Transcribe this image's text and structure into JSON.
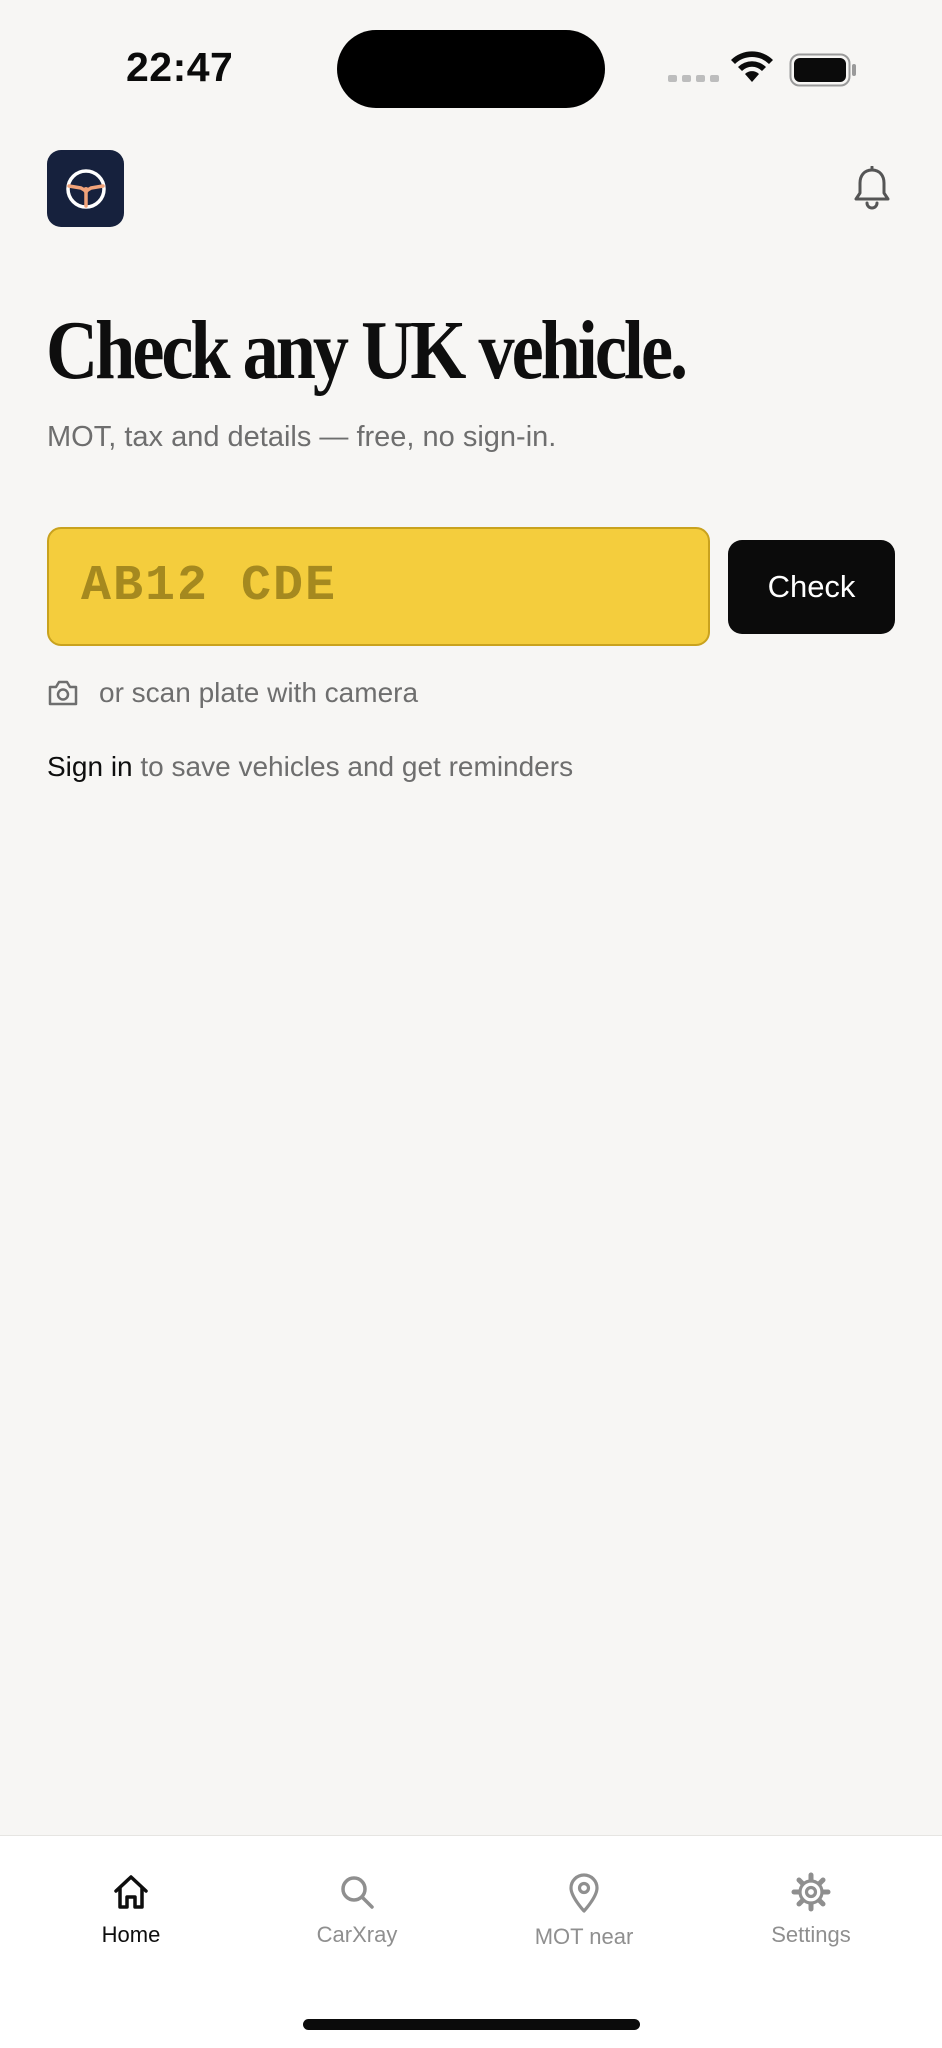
{
  "status": {
    "time": "22:47"
  },
  "header": {
    "logo_icon": "steering-wheel-icon",
    "notification_icon": "bell-icon"
  },
  "hero": {
    "title": "Check any UK vehicle.",
    "subtitle": "MOT, tax and details — free, no sign-in."
  },
  "plate": {
    "value": "",
    "placeholder": "AB12 CDE",
    "check_label": "Check"
  },
  "scan": {
    "label": "or scan plate with camera"
  },
  "signin": {
    "link": "Sign in",
    "text": " to save vehicles and get reminders"
  },
  "tabs": [
    {
      "label": "Home",
      "icon": "home-icon",
      "active": true
    },
    {
      "label": "CarXray",
      "icon": "search-icon",
      "active": false
    },
    {
      "label": "MOT near",
      "icon": "location-pin-icon",
      "active": false
    },
    {
      "label": "Settings",
      "icon": "gear-icon",
      "active": false
    }
  ],
  "colors": {
    "background": "#f7f6f4",
    "plate_yellow": "#f4cd3d",
    "logo_navy": "#16213d",
    "logo_accent": "#f1a37a",
    "button_black": "#0b0b0b",
    "muted_text": "#6e6e6e"
  }
}
